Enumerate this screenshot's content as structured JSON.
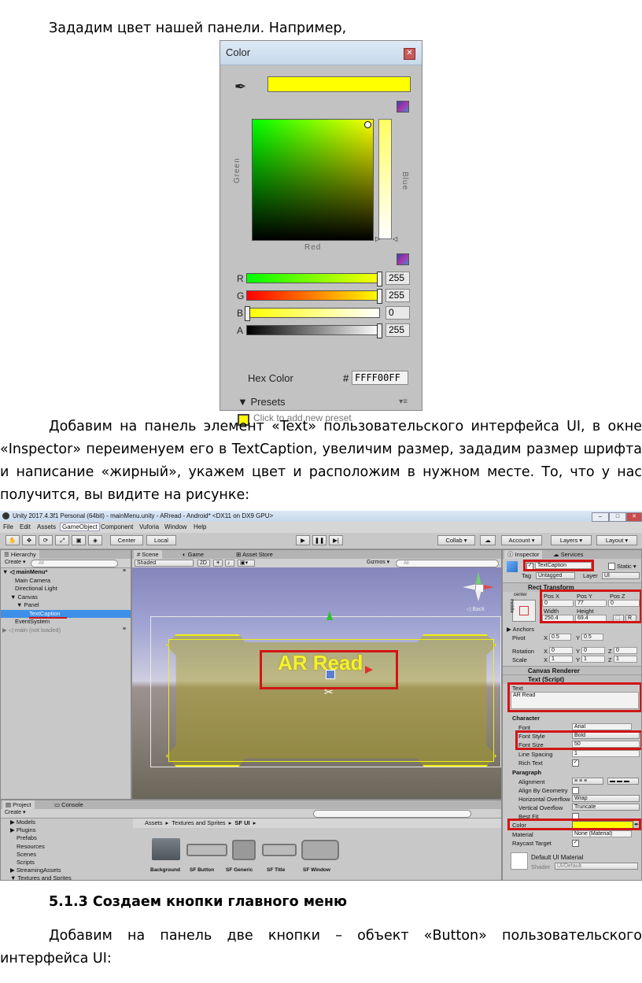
{
  "text": {
    "line1": "Зададим цвет нашей панели. Например,",
    "para2": "Добавим на панель элемент «Text» пользовательского интерфейса UI, в окне «Inspector» переименуем его в TextCaption, увеличим размер, зададим размер шрифта и написание «жирный», укажем цвет и расположим в нужном месте. То, что у нас получится, вы видите на рисунке:",
    "heading": "5.1.3 Создаем кнопки главного меню",
    "para3": "Добавим на панель две кнопки – объект «Button» пользовательского интерфейса UI:"
  },
  "color_picker": {
    "title": "Color",
    "swatch_color": "#FFFF00",
    "label_green": "Green",
    "label_blue": "Blue",
    "label_red": "Red",
    "sliders": [
      {
        "channel": "R",
        "value": "255",
        "fraction": 1.0,
        "gradient": "linear-gradient(to right,#00ff00,#ffff00)"
      },
      {
        "channel": "G",
        "value": "255",
        "fraction": 1.0,
        "gradient": "linear-gradient(to right,#ff0000,#ffff00)"
      },
      {
        "channel": "B",
        "value": "0",
        "fraction": 0.0,
        "gradient": "linear-gradient(to right,#ffff00,#ffffff)"
      },
      {
        "channel": "A",
        "value": "255",
        "fraction": 1.0,
        "gradient": "linear-gradient(to right,#000000,#ffffff)"
      }
    ],
    "hex_label": "Hex Color",
    "hash": "#",
    "hex_value": "FFFF00FF",
    "presets_label": "Presets",
    "add_preset": "Click to add new preset"
  },
  "unity": {
    "title": "Unity 2017.4.3f1 Personal (64bit) - mainMenu.unity - ARread - Android* <DX11 on DX9 GPU>",
    "menu": [
      "File",
      "Edit",
      "Assets",
      "GameObject",
      "Component",
      "Vuforia",
      "Window",
      "Help"
    ],
    "toolbar": {
      "center": "Center",
      "local": "Local",
      "collab": "Collab ▾",
      "account": "Account ▾",
      "layers": "Layers ▾",
      "layout": "Layout ▾"
    },
    "hierarchy": {
      "tab": "Hierarchy",
      "create": "Create ▾",
      "search": "All",
      "items": [
        {
          "label": "▼ ◁ mainMenu*",
          "indent": 2,
          "selected": false,
          "bold": true
        },
        {
          "label": "Main Camera",
          "indent": 18,
          "selected": false,
          "bold": false
        },
        {
          "label": "Directional Light",
          "indent": 18,
          "selected": false,
          "bold": false
        },
        {
          "label": "▼ Canvas",
          "indent": 12,
          "selected": false,
          "bold": false
        },
        {
          "label": "▼ Panel",
          "indent": 20,
          "selected": false,
          "bold": false
        },
        {
          "label": "TextCaption",
          "indent": 36,
          "selected": true,
          "bold": false
        },
        {
          "label": "EventSystem",
          "indent": 18,
          "selected": false,
          "bold": false
        },
        {
          "label": "▶ ◁ main (not loaded)",
          "indent": 2,
          "selected": false,
          "bold": false
        }
      ]
    },
    "scene": {
      "tabs": [
        "Scene",
        "Game",
        "Asset Store"
      ],
      "shaded": "Shaded",
      "mode2d": "2D",
      "gizmos": "Gizmos ▾",
      "search": "All",
      "back": "◁ Back",
      "ar_text": "AR Read"
    },
    "inspector": {
      "tabs": [
        "Inspector",
        "Services"
      ],
      "name": "TextCaption",
      "static": "Static ▾",
      "tag_label": "Tag",
      "tag": "Untagged",
      "layer_label": "Layer",
      "layer": "UI",
      "rect_transform": "Rect Transform",
      "anchor_preset": "center",
      "side_label": "middle",
      "pos_headers": [
        "Pos X",
        "Pos Y",
        "Pos Z"
      ],
      "pos_values": [
        "0",
        "77",
        "0"
      ],
      "size_headers": [
        "Width",
        "Height"
      ],
      "size_values": [
        "250.4",
        "69.4"
      ],
      "anchors": "▶ Anchors",
      "pivot_label": "Pivot",
      "pivot": [
        "X",
        "0.5",
        "Y",
        "0.5"
      ],
      "rotation_label": "Rotation",
      "rotation": [
        "X",
        "0",
        "Y",
        "0",
        "Z",
        "0"
      ],
      "scale_label": "Scale",
      "scale": [
        "X",
        "1",
        "Y",
        "1",
        "Z",
        "1"
      ],
      "canvas_renderer": "Canvas Renderer",
      "text_script": "Text (Script)",
      "text_label": "Text",
      "text_value": "AR Read",
      "character": "Character",
      "font_label": "Font",
      "font": "Arial",
      "font_style_label": "Font Style",
      "font_style": "Bold",
      "font_size_label": "Font Size",
      "font_size": "50",
      "line_spacing_label": "Line Spacing",
      "line_spacing": "1",
      "rich_text_label": "Rich Text",
      "paragraph": "Paragraph",
      "alignment_label": "Alignment",
      "align_geom_label": "Align By Geometry",
      "h_overflow_label": "Horizontal Overflow",
      "h_overflow": "Wrap",
      "v_overflow_label": "Vertical Overflow",
      "v_overflow": "Truncate",
      "best_fit_label": "Best Fit",
      "color_label": "Color",
      "color_value": "#FFFF00",
      "material_label": "Material",
      "material": "None (Material)",
      "raycast_label": "Raycast Target",
      "default_material": "Default UI Material",
      "shader_label": "Shader",
      "shader": "UI/Default"
    },
    "project": {
      "tabs": [
        "Project",
        "Console"
      ],
      "create": "Create ▾",
      "tree": [
        "▶ Models",
        "▶ Plugins",
        "Prefabs",
        "Resources",
        "Scenes",
        "Scripts",
        "▶ StreamingAssets",
        "▼ Textures and Sprites"
      ],
      "breadcrumb": [
        "Assets",
        "Textures and Sprites",
        "SF UI"
      ],
      "assets": [
        "Background",
        "SF Button",
        "SF Generic",
        "SF Title",
        "SF Window"
      ]
    }
  }
}
